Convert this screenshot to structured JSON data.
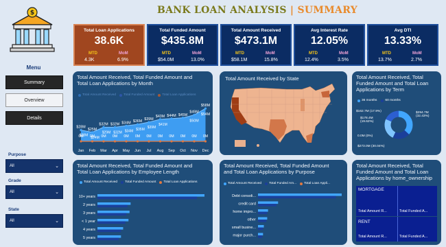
{
  "header": {
    "title_part1": "BANK LOAN ANALYSIS",
    "separator": "|",
    "title_part2": "SUMMARY"
  },
  "sidebar": {
    "menu_title": "Menu",
    "nav": [
      {
        "label": "Summary"
      },
      {
        "label": "Overview"
      },
      {
        "label": "Details"
      }
    ],
    "filters": [
      {
        "label": "Purpose",
        "value": "All"
      },
      {
        "label": "Grade",
        "value": "All"
      },
      {
        "label": "State",
        "value": "All"
      }
    ]
  },
  "kpis": [
    {
      "label": "Total Loan Applications",
      "value": "38.6K",
      "mtd_label": "MTD",
      "mom_label": "MoM",
      "mtd": "4.3K",
      "mom": "6.9%"
    },
    {
      "label": "Total Funded Amount",
      "value": "$435.8M",
      "mtd_label": "MTD",
      "mom_label": "MoM",
      "mtd": "$54.0M",
      "mom": "13.0%"
    },
    {
      "label": "Total Amount Received",
      "value": "$473.1M",
      "mtd_label": "MTD",
      "mom_label": "MoM",
      "mtd": "$58.1M",
      "mom": "15.8%"
    },
    {
      "label": "Avg Interest Rate",
      "value": "12.05%",
      "mtd_label": "MTD",
      "mom_label": "MoM",
      "mtd": "12.4%",
      "mom": "3.5%"
    },
    {
      "label": "Avg DTI",
      "value": "13.33%",
      "mtd_label": "MTD",
      "mom_label": "MoM",
      "mtd": "13.7%",
      "mom": "2.7%"
    }
  ],
  "panels": {
    "monthly": {
      "title_line1": "Total Amount Received, Total Funded Amount and",
      "title_line2": "Total Loan Applications by Month"
    },
    "state": {
      "title": "Total Amount Received by State"
    },
    "term": {
      "title_line1": "Total Amount Received, Total",
      "title_line2": "Funded Amount and Total Loan",
      "title_line3": "Applications by Term",
      "legend": [
        "36 months",
        "60 months"
      ],
      "labels": [
        "$162.7M (17.9%)",
        "$178.4M (19.62%)",
        "$294.7M (32.43%)",
        "0.0M (0%)",
        "$273.0M (30.04%)"
      ]
    },
    "emp": {
      "title_line1": "Total Amount Received, Total Funded Amount and",
      "title_line2": "Total Loan Applications by Employee Length",
      "legend": [
        "Total Amount Received",
        "Total Funded Amount",
        "Total Loan Applications"
      ]
    },
    "purpose": {
      "title_line1": "Total Amount Received, Total Funded Amount",
      "title_line2": "and Total Loan Applications by Purpose",
      "legend": [
        "Total Amount Received",
        "Total Funded Am...",
        "Total Loan Appli..."
      ],
      "categories": [
        "Debt consoli...",
        "credit card",
        "home impro...",
        "other",
        "small busine...",
        "major purch..."
      ]
    },
    "home": {
      "title_line1": "Total Amount Received, Total",
      "title_line2": "Funded Amount and Total Loan",
      "title_line3": "Applications by home_ownership",
      "tiles": [
        "MORTGAGE",
        "RENT"
      ],
      "tile_labels": [
        "Total Amount R...",
        "Total Funded A...",
        "Total Amount R...",
        "Total Funded A..."
      ]
    }
  },
  "chart_data": [
    {
      "type": "line",
      "categories": [
        "Jan",
        "Feb",
        "Mar",
        "Apr",
        "May",
        "Jun",
        "Jul",
        "Aug",
        "Sep",
        "Oct",
        "Nov",
        "Dec"
      ],
      "series": [
        {
          "name": "Total Amount Received",
          "labels": [
            "$28M",
            "$25M",
            "$32M",
            "$32M",
            "$34M",
            "$36M",
            "$39M",
            "$43M",
            "$44M",
            "$45M",
            "$49M",
            "$58M"
          ]
        },
        {
          "name": "Total Funded Amount",
          "labels": [
            "",
            "",
            "",
            "",
            "",
            "",
            "",
            "",
            "",
            "",
            "$50M",
            "$54M"
          ]
        },
        {
          "name": "Total Loan Applications",
          "labels": [
            "0M",
            "0M",
            "0M",
            "0M",
            "0M",
            "0M",
            "0M",
            "0M",
            "0M",
            "0M",
            "0M",
            "0M"
          ]
        }
      ],
      "extra_labels": [
        "$28M",
        "$24M",
        "$29M",
        "$32M",
        "$34M",
        "$35M",
        "$39M",
        "$41M"
      ],
      "colors": {
        "received": "#41a6ff",
        "funded": "#1b3f9a",
        "applications": "#e07840"
      }
    },
    {
      "type": "bar",
      "orientation": "horizontal",
      "categories": [
        "10+ years",
        "2 years",
        "3 years",
        "< 1 year",
        "4 years",
        "5 years"
      ],
      "series": [
        {
          "name": "Total Amount Received",
          "values": [
            1.0,
            0.31,
            0.3,
            0.29,
            0.24,
            0.22
          ]
        },
        {
          "name": "Total Funded Amount",
          "values": [
            0.93,
            0.28,
            0.27,
            0.26,
            0.22,
            0.2
          ]
        }
      ]
    },
    {
      "type": "bar",
      "orientation": "horizontal",
      "categories": [
        "Debt consoli...",
        "credit card",
        "home impro...",
        "other",
        "small busine...",
        "major purch..."
      ],
      "series": [
        {
          "name": "Total Amount Received",
          "values": [
            1.0,
            0.24,
            0.12,
            0.11,
            0.07,
            0.06
          ]
        },
        {
          "name": "Total Funded Amount",
          "values": [
            0.93,
            0.22,
            0.11,
            0.1,
            0.06,
            0.05
          ]
        }
      ]
    }
  ]
}
